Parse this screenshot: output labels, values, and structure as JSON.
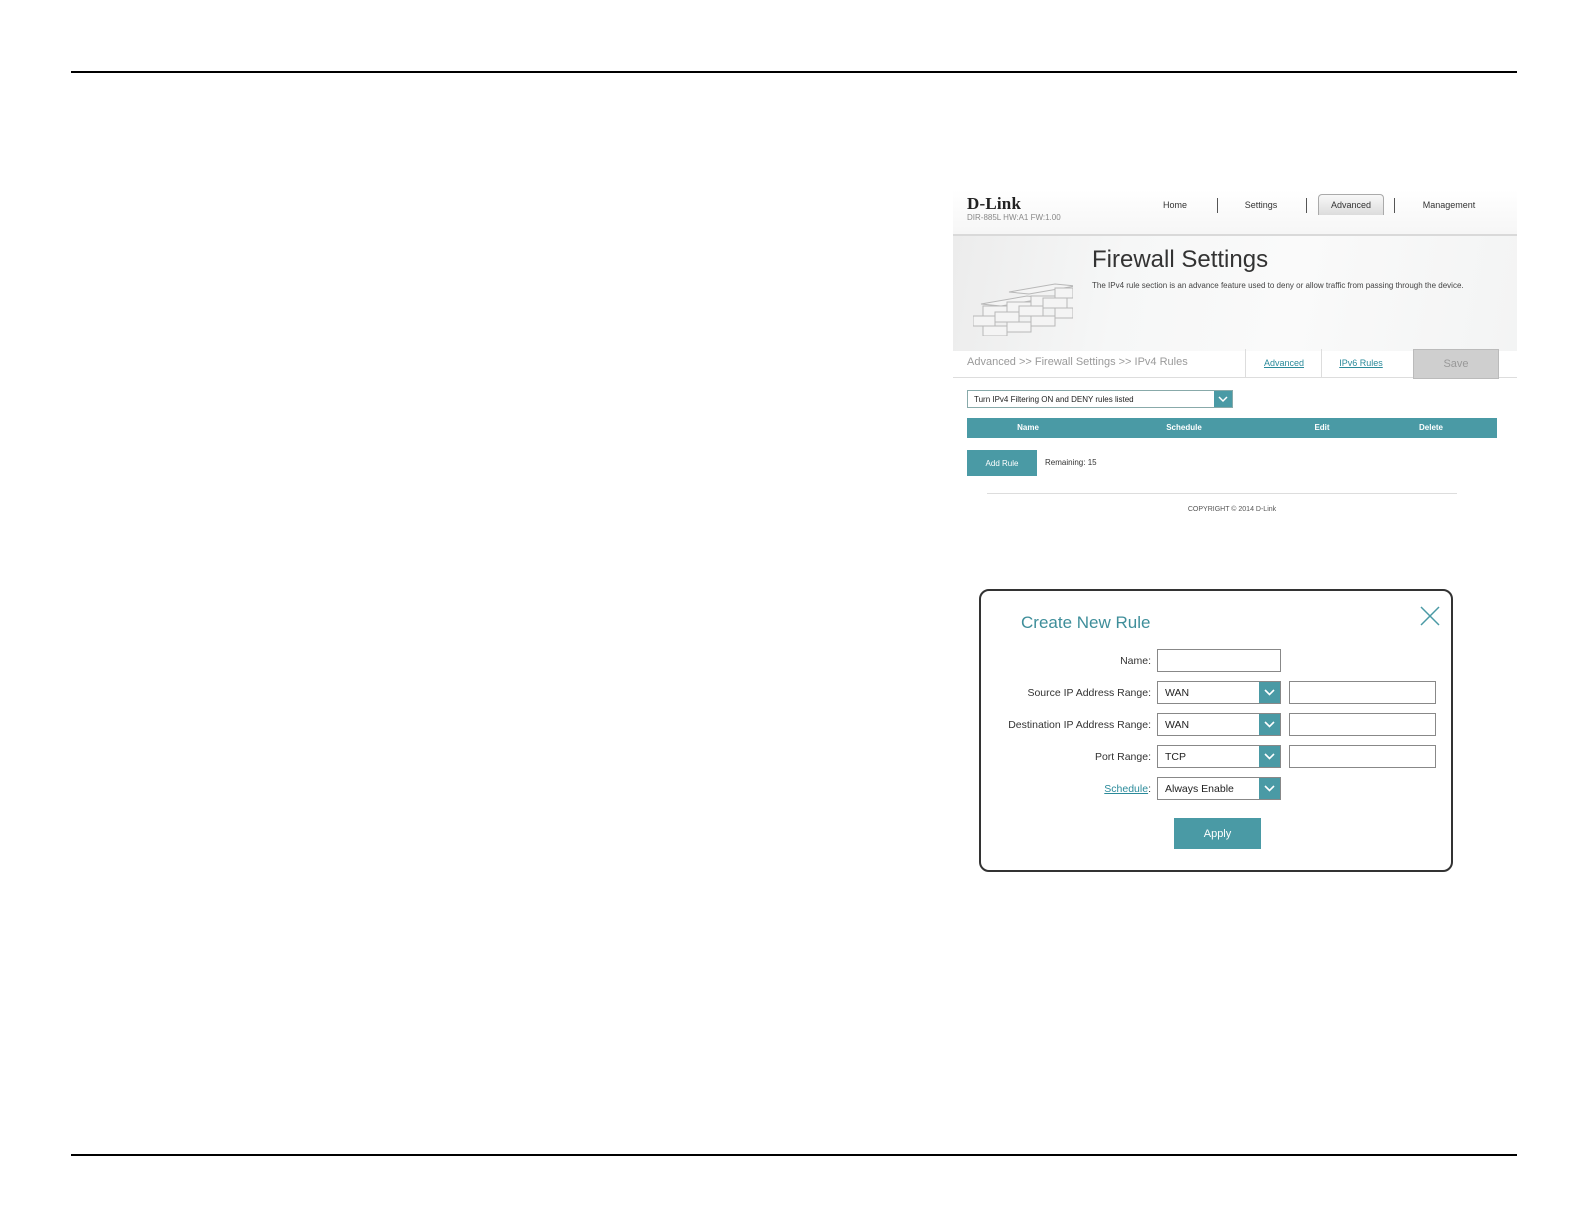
{
  "router": {
    "brand": "D-Link",
    "model_info": "DIR-885L   HW:A1   FW:1.00",
    "nav": [
      "Home",
      "Settings",
      "Advanced",
      "Management"
    ],
    "active_nav": "Advanced",
    "banner": {
      "title": "Firewall Settings",
      "description": "The IPv4 rule section is an advance feature used to deny or allow traffic from passing through the device."
    },
    "breadcrumb": "Advanced >> Firewall Settings >> IPv4 Rules",
    "links": [
      "Advanced",
      "IPv6 Rules"
    ],
    "save_label": "Save",
    "filter_value": "Turn IPv4 Filtering ON and DENY rules listed",
    "table_columns": [
      "Name",
      "Schedule",
      "Edit",
      "Delete"
    ],
    "add_rule_label": "Add Rule",
    "remaining": "Remaining: 15",
    "copyright": "COPYRIGHT © 2014 D-Link"
  },
  "modal": {
    "title": "Create New Rule",
    "name_label": "Name:",
    "source_label": "Source IP Address Range:",
    "source_value": "WAN",
    "dest_label": "Destination IP Address Range:",
    "dest_value": "WAN",
    "port_label": "Port Range:",
    "port_value": "TCP",
    "schedule_label": "Schedule",
    "schedule_colon": ":",
    "schedule_value": "Always Enable",
    "apply_label": "Apply"
  },
  "colors": {
    "accent": "#4a9aa5",
    "link": "#2a8a9a"
  }
}
